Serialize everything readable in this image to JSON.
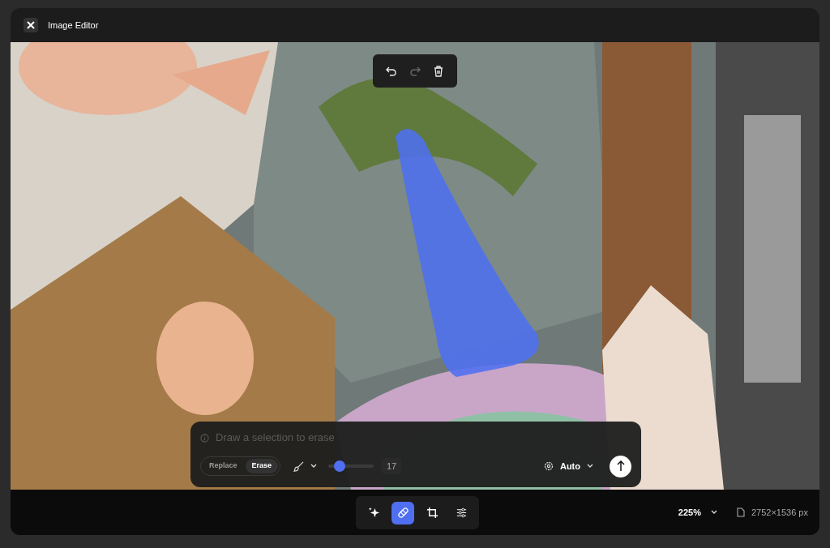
{
  "window": {
    "title": "Image Editor"
  },
  "history_toolbar": [
    {
      "kind": "undo",
      "disabled": false
    },
    {
      "kind": "redo",
      "disabled": true
    },
    {
      "kind": "delete",
      "disabled": false
    }
  ],
  "prompt": {
    "placeholder": "Draw a selection to erase"
  },
  "modes": [
    {
      "label": "Replace",
      "selected": false
    },
    {
      "label": "Erase",
      "selected": true
    }
  ],
  "brush": {
    "level": 0.17,
    "reading": "17"
  },
  "quality": {
    "label": "Auto"
  },
  "tools": [
    {
      "kind": "generate",
      "selected": false
    },
    {
      "kind": "heal",
      "selected": true
    },
    {
      "kind": "crop",
      "selected": false
    },
    {
      "kind": "adjust",
      "selected": false
    }
  ],
  "zoom": "225%",
  "dimensions": "2752×1536 px"
}
